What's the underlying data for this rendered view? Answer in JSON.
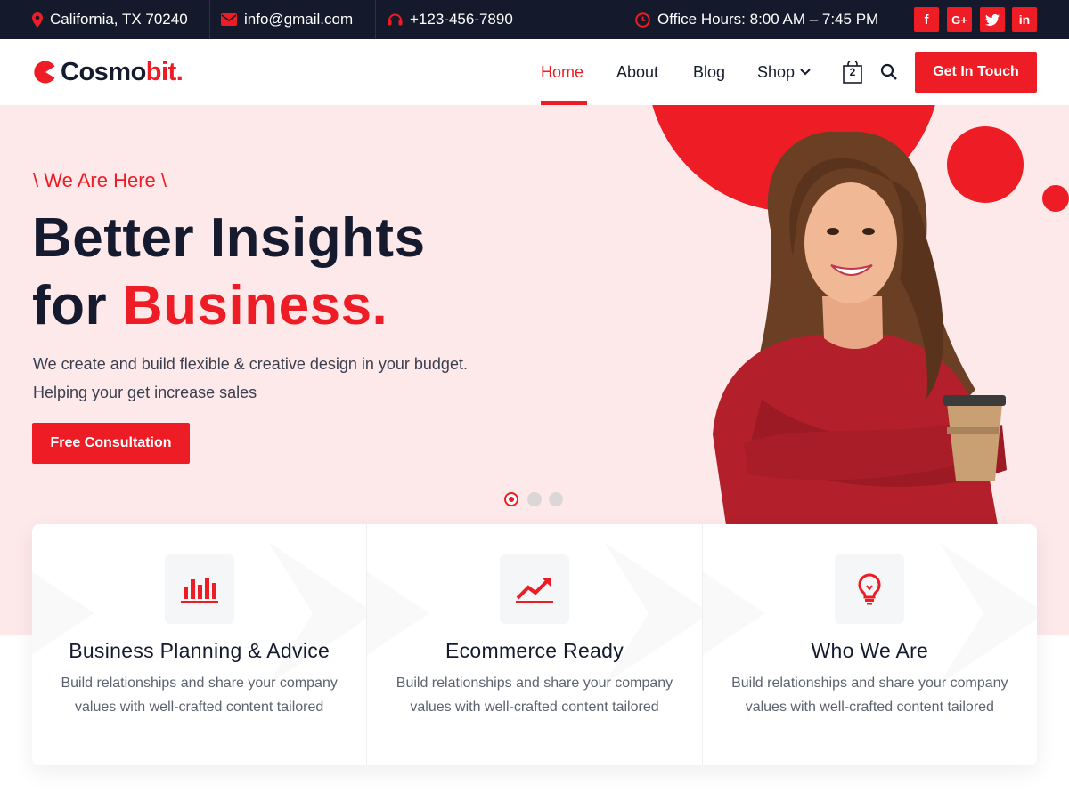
{
  "topbar": {
    "address": "California, TX 70240",
    "email": "info@gmail.com",
    "phone": "+123-456-7890",
    "office_hours": "Office Hours: 8:00 AM – 7:45 PM",
    "social": [
      {
        "name": "facebook-icon",
        "glyph": "f"
      },
      {
        "name": "google-plus-icon",
        "glyph": "G+"
      },
      {
        "name": "twitter-icon",
        "glyph": "t"
      },
      {
        "name": "linkedin-icon",
        "glyph": "in"
      }
    ]
  },
  "header": {
    "logo_main": "Cosmo",
    "logo_accent": "bit.",
    "nav": [
      "Home",
      "About",
      "Blog",
      "Shop"
    ],
    "active_nav": "Home",
    "cart_count": "2",
    "cta_label": "Get In Touch"
  },
  "hero": {
    "eyebrow": "\\ We Are Here \\",
    "headline_line1": "Better Insights",
    "headline_line2_prefix": "for ",
    "headline_line2_accent": "Business.",
    "description": "We create and build flexible & creative design in your budget. Helping your get increase sales",
    "button_label": "Free Consultation",
    "slide_count": 3,
    "active_slide": 1
  },
  "features": [
    {
      "icon": "bar-chart-icon",
      "title": "Business Planning & Advice",
      "text": "Build relationships and share your company values with well-crafted content tailored"
    },
    {
      "icon": "trend-up-icon",
      "title": "Ecommerce Ready",
      "text": "Build relationships and share your company values with well-crafted content tailored"
    },
    {
      "icon": "lightbulb-icon",
      "title": "Who We Are",
      "text": "Build relationships and share your company values with well-crafted content tailored"
    }
  ],
  "colors": {
    "accent": "#ee1c24",
    "dark": "#141a2b",
    "hero_bg": "#fde8ea"
  }
}
